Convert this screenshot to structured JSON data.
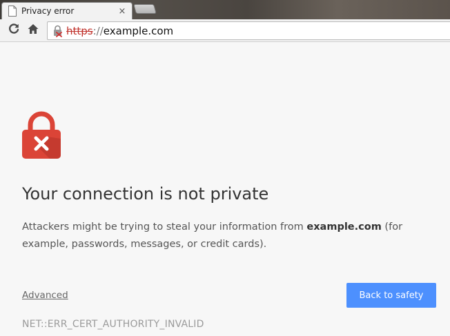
{
  "tab": {
    "title": "Privacy error",
    "favicon": "page-icon",
    "close_glyph": "×"
  },
  "toolbar": {
    "reload_icon": "reload-icon",
    "home_icon": "home-icon",
    "url": {
      "security_icon": "broken-lock-icon",
      "scheme": "https",
      "separator": "://",
      "host": "example.com"
    }
  },
  "interstitial": {
    "icon": "red-lock-x-icon",
    "heading": "Your connection is not private",
    "explanation_prefix": "Attackers might be trying to steal your information from ",
    "explanation_host": "example.com",
    "explanation_suffix": " (for example, passwords, messages, or credit cards).",
    "advanced_label": "Advanced",
    "back_button_label": "Back to safety",
    "error_code": "NET::ERR_CERT_AUTHORITY_INVALID"
  },
  "colors": {
    "accent": "#4d90fe",
    "danger": "#db4437",
    "page_background": "#f7f7f7"
  }
}
